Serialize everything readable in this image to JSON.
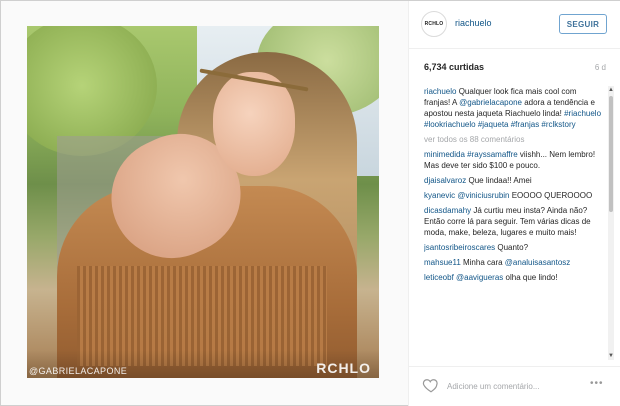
{
  "post": {
    "photo_credit": "@GABRIELACAPONE",
    "photo_brand": "RCHLO"
  },
  "header": {
    "avatar_text": "RCHLO",
    "username": "riachuelo",
    "follow_label": "SEGUIR"
  },
  "stats": {
    "likes": "6,734 curtidas",
    "time": "6 d"
  },
  "comments": {
    "caption": {
      "user": "riachuelo",
      "text_1": " Qualquer look fica mais cool com franjas! A ",
      "mention": "@gabrielacapone",
      "text_2": " adora a tendência e apostou nesta jaqueta Riachuelo linda! ",
      "hashtags": "#riachuelo #lookriachuelo #jaqueta #franjas #rclkstory"
    },
    "view_all": "ver todos os 88 comentários",
    "list": [
      {
        "user": "minimedida",
        "mention": "#rayssamaffre",
        "text": " viishh... Nem lembro! Mas deve ter sido $100 e pouco."
      },
      {
        "user": "djaisalvaroz",
        "mention": "",
        "text": " Que lindaa!! Amei"
      },
      {
        "user": "kyanevic",
        "mention": "@viniciusrubin",
        "text": " EOOOO QUEROOOO"
      },
      {
        "user": "dicasdamahy",
        "mention": "",
        "text": " Já curtiu meu insta? Ainda não? Então corre lá para seguir. Tem várias dicas de moda, make, beleza, lugares e muito mais!"
      },
      {
        "user": "jsantosribeiroscares",
        "mention": "",
        "text": " Quanto?"
      },
      {
        "user": "mahsue11",
        "mention": "@analuisasantosz",
        "text": " Minha cara"
      },
      {
        "user": "leticeobf",
        "mention": "@aavigueras",
        "text": " olha que lindo!"
      }
    ]
  },
  "footer": {
    "add_comment_placeholder": "Adicione um comentário...",
    "more_label": "•••"
  },
  "icons": {
    "like": "heart-icon",
    "scroll_up": "scroll-up-arrow-icon",
    "scroll_down": "scroll-down-arrow-icon"
  },
  "colors": {
    "link": "#125688",
    "follow_border": "#70a4d0",
    "muted": "#a5a7aa"
  }
}
